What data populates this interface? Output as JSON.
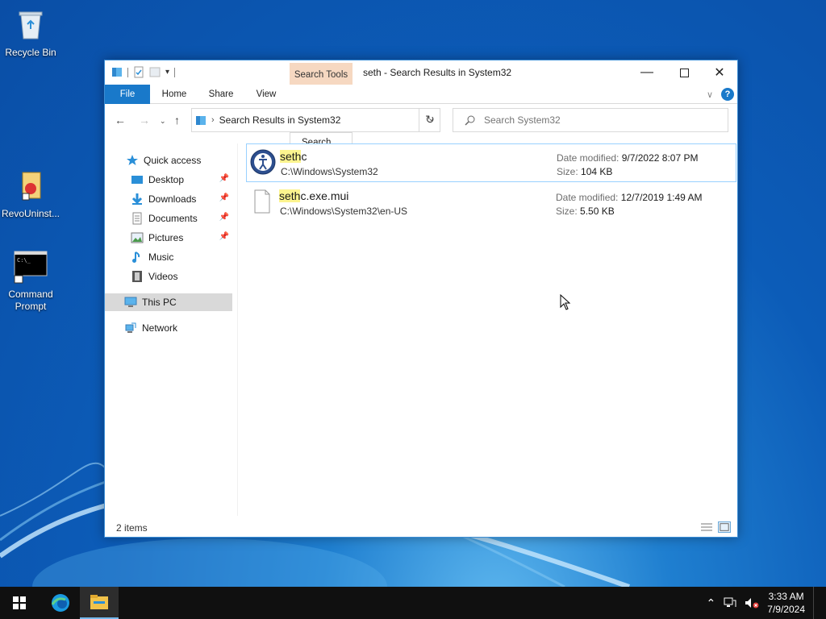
{
  "desktop": {
    "icons": [
      {
        "label": "Recycle Bin"
      },
      {
        "label": "RevoUninst..."
      },
      {
        "label": "Command Prompt"
      }
    ]
  },
  "window": {
    "title": "seth - Search Results in System32",
    "contextual_tab": "Search Tools",
    "ribbon_tabs": [
      "File",
      "Home",
      "Share",
      "View",
      "Search"
    ],
    "address": "Search Results in System32",
    "search_placeholder": "Search System32",
    "nav": {
      "quick_access": "Quick access",
      "items": [
        {
          "label": "Desktop",
          "pinned": true
        },
        {
          "label": "Downloads",
          "pinned": true
        },
        {
          "label": "Documents",
          "pinned": true
        },
        {
          "label": "Pictures",
          "pinned": true
        },
        {
          "label": "Music",
          "pinned": false
        },
        {
          "label": "Videos",
          "pinned": false
        }
      ],
      "this_pc": "This PC",
      "network": "Network"
    },
    "results": [
      {
        "name_highlight": "seth",
        "name_rest": "c",
        "path": "C:\\Windows\\System32",
        "date_label": "Date modified:",
        "date": "9/7/2022 8:07 PM",
        "size_label": "Size:",
        "size": "104 KB"
      },
      {
        "name_highlight": "seth",
        "name_rest": "c.exe.mui",
        "path": "C:\\Windows\\System32\\en-US",
        "date_label": "Date modified:",
        "date": "12/7/2019 1:49 AM",
        "size_label": "Size:",
        "size": "5.50 KB"
      }
    ],
    "status": "2 items"
  },
  "taskbar": {
    "time": "3:33 AM",
    "date": "7/9/2024"
  },
  "colors": {
    "accent": "#1979ca",
    "context_tab": "#f6d8c1",
    "highlight": "#fcf48f",
    "selection_border": "#99d1ff"
  }
}
